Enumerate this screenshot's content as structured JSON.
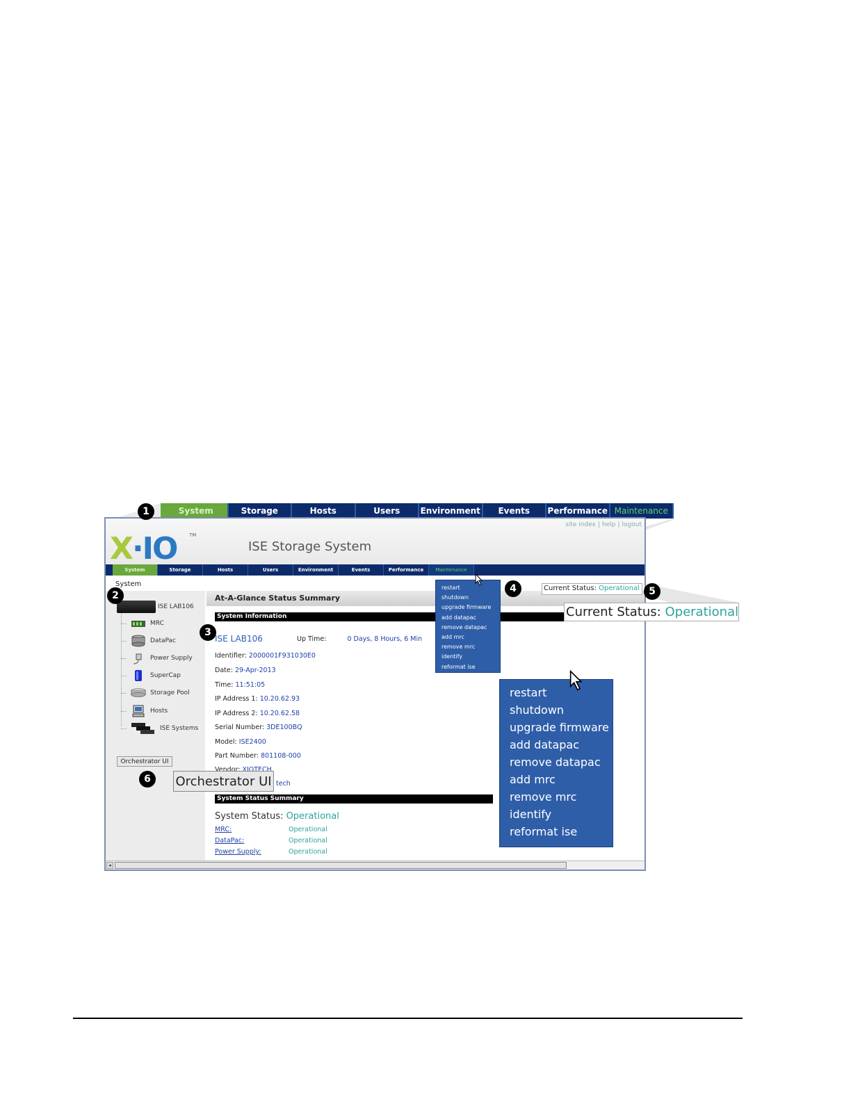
{
  "bignav": {
    "items": [
      "System",
      "Storage",
      "Hosts",
      "Users",
      "Environment",
      "Events",
      "Performance",
      "Maintenance"
    ]
  },
  "header": {
    "logo_text": "X·IO",
    "logo_tm": "TM",
    "title": "ISE Storage System",
    "links": [
      "site index",
      "|",
      "help",
      "|",
      "logout"
    ]
  },
  "smallnav": {
    "items": [
      "System",
      "Storage",
      "Hosts",
      "Users",
      "Environment",
      "Events",
      "Performance",
      "Maintenance"
    ]
  },
  "breadcrumb": "System",
  "tree": {
    "root": "ISE LAB106",
    "items": [
      "MRC",
      "DataPac",
      "Power Supply",
      "SuperCap",
      "Storage Pool",
      "Hosts",
      "ISE Systems"
    ]
  },
  "orchestrator_button": "Orchestrator UI",
  "summary": {
    "heading": "At-A-Glance Status Summary",
    "system_info_label": "System Information",
    "system_name": "ISE LAB106",
    "uptime_label": "Up Time:",
    "uptime_value": "0 Days, 8 Hours, 6 Min",
    "fields": [
      {
        "label": "Identifier:",
        "value": "2000001F931030E0"
      },
      {
        "label": "Date:",
        "value": "29-Apr-2013"
      },
      {
        "label": "Time:",
        "value": "11:51:05"
      },
      {
        "label": "IP Address 1:",
        "value": "10.20.62.93"
      },
      {
        "label": "IP Address 2:",
        "value": "10.20.62.58"
      },
      {
        "label": "Serial Number:",
        "value": "3DE100BQ"
      },
      {
        "label": "Model:",
        "value": "ISE2400"
      },
      {
        "label": "Part Number:",
        "value": "801108-000"
      },
      {
        "label": "Vendor:",
        "value": "XIOTECH"
      }
    ],
    "partial_tech": "tech",
    "status_summary_label": "System Status Summary",
    "system_status_label": "System Status:",
    "system_status_value": "Operational",
    "components": [
      {
        "name": "MRC:",
        "status": "Operational"
      },
      {
        "name": "DataPac:",
        "status": "Operational"
      },
      {
        "name": "Power Supply:",
        "status": "Operational"
      }
    ]
  },
  "maintenance_menu": [
    "restart",
    "shutdown",
    "upgrade firmware",
    "add datapac",
    "remove datapac",
    "add mrc",
    "remove mrc",
    "identify",
    "reformat ise"
  ],
  "current_status": {
    "label": "Current Status:",
    "value": "Operational"
  },
  "callouts": [
    "1",
    "2",
    "3",
    "4",
    "5",
    "6"
  ],
  "colors": {
    "nav_bg": "#0d2b6b",
    "nav_active": "#6aa83e",
    "menu_bg": "#2f5ea9",
    "operational": "#2da39a"
  }
}
